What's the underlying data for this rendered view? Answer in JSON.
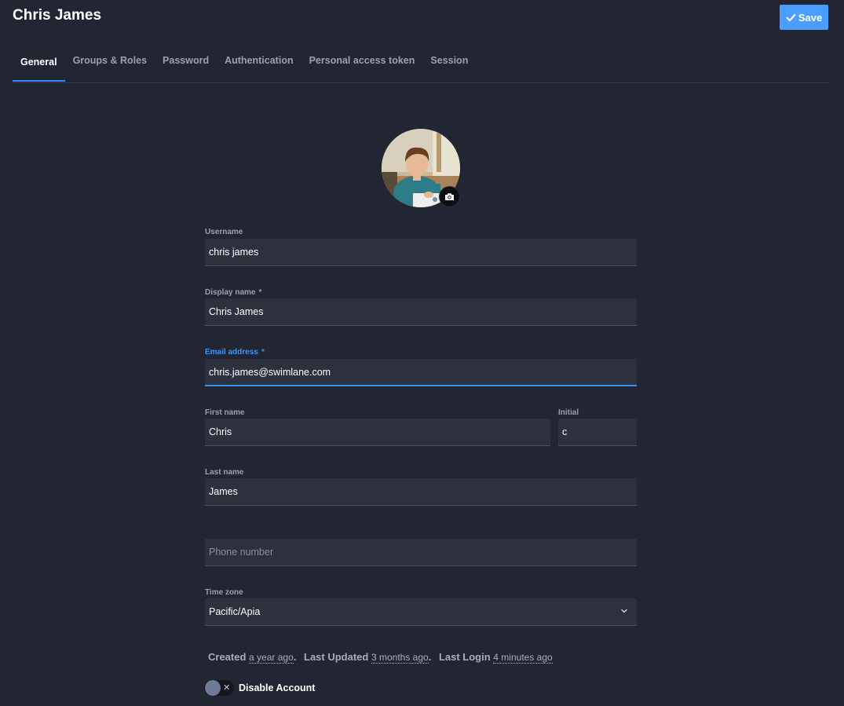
{
  "header": {
    "title": "Chris James",
    "save_label": "Save"
  },
  "tabs": [
    {
      "label": "General",
      "active": true
    },
    {
      "label": "Groups & Roles"
    },
    {
      "label": "Password"
    },
    {
      "label": "Authentication"
    },
    {
      "label": "Personal access token"
    },
    {
      "label": "Session"
    }
  ],
  "form": {
    "username": {
      "label": "Username",
      "value": "chris james"
    },
    "display_name": {
      "label": "Display name",
      "required": "*",
      "value": "Chris James"
    },
    "email": {
      "label": "Email address",
      "required": "*",
      "value": "chris.james@swimlane.com"
    },
    "first_name": {
      "label": "First name",
      "value": "Chris"
    },
    "initial": {
      "label": "Initial",
      "value": "c"
    },
    "last_name": {
      "label": "Last name",
      "value": "James"
    },
    "phone": {
      "placeholder": "Phone number",
      "value": ""
    },
    "time_zone": {
      "label": "Time zone",
      "value": "Pacific/Apia"
    }
  },
  "meta": {
    "created_label": "Created",
    "created_value": "a year ago",
    "updated_label": "Last Updated",
    "updated_value": "3 months ago",
    "login_label": "Last Login",
    "login_value": "4 minutes ago"
  },
  "disable_account": {
    "label": "Disable Account",
    "enabled": false
  },
  "colors": {
    "background": "#222633",
    "field": "#2c313d",
    "accent": "#3a93f2",
    "save_button": "#4a9eff"
  }
}
